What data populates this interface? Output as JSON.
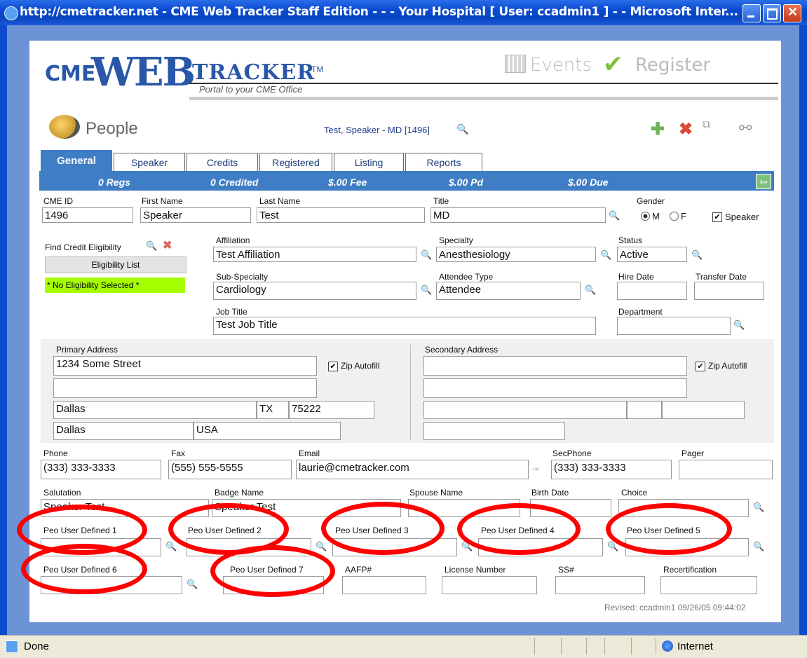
{
  "window": {
    "title": "http://cmetracker.net - CME Web Tracker Staff Edition - - - Your Hospital [ User: ccadmin1 ] - - Microsoft Inter..."
  },
  "header": {
    "logo_cme": "CME",
    "logo_web": "WEB",
    "logo_tracker": "TRACKER",
    "logo_tm": "TM",
    "tagline": "Portal to your CME Office",
    "events_label": "Events",
    "register_label": "Register"
  },
  "people": {
    "label": "People",
    "record_title": "Test, Speaker - MD [1496]"
  },
  "tabs": [
    {
      "label": "General"
    },
    {
      "label": "Speaker"
    },
    {
      "label": "Credits"
    },
    {
      "label": "Registered"
    },
    {
      "label": "Listing"
    },
    {
      "label": "Reports"
    }
  ],
  "stats": {
    "regs": "0 Regs",
    "credited": "0 Credited",
    "fee": "$.00 Fee",
    "pd": "$.00 Pd",
    "due": "$.00 Due"
  },
  "form": {
    "cme_id": {
      "label": "CME ID",
      "value": "1496"
    },
    "first_name": {
      "label": "First Name",
      "value": "Speaker"
    },
    "last_name": {
      "label": "Last Name",
      "value": "Test"
    },
    "title": {
      "label": "Title",
      "value": "MD"
    },
    "gender": {
      "label": "Gender",
      "m": "M",
      "f": "F",
      "selected": "M"
    },
    "speaker_check": {
      "label": "Speaker",
      "checked": true
    },
    "eligibility": {
      "label": "Find Credit Eligibility",
      "list_button": "Eligibility List",
      "none": "* No Eligibility Selected *"
    },
    "affiliation": {
      "label": "Affiliation",
      "value": "Test Affiliation"
    },
    "specialty": {
      "label": "Specialty",
      "value": "Anesthesiology"
    },
    "status": {
      "label": "Status",
      "value": "Active"
    },
    "sub_specialty": {
      "label": "Sub-Specialty",
      "value": "Cardiology"
    },
    "attendee_type": {
      "label": "Attendee Type",
      "value": "Attendee"
    },
    "hire_date": {
      "label": "Hire Date",
      "value": ""
    },
    "transfer_date": {
      "label": "Transfer Date",
      "value": ""
    },
    "job_title": {
      "label": "Job Title",
      "value": "Test Job Title"
    },
    "department": {
      "label": "Department",
      "value": ""
    },
    "primary_address": {
      "label": "Primary Address",
      "line1": "1234 Some Street",
      "line2": "",
      "city": "Dallas",
      "state": "TX",
      "zip": "75222",
      "county": "Dallas",
      "country": "USA",
      "zip_autofill": "Zip Autofill"
    },
    "secondary_address": {
      "label": "Secondary Address",
      "zip_autofill": "Zip Autofill"
    },
    "phone": {
      "label": "Phone",
      "value": "(333) 333-3333"
    },
    "fax": {
      "label": "Fax",
      "value": "(555) 555-5555"
    },
    "email": {
      "label": "Email",
      "value": "laurie@cmetracker.com"
    },
    "secphone": {
      "label": "SecPhone",
      "value": "(333) 333-3333"
    },
    "pager": {
      "label": "Pager",
      "value": ""
    },
    "salutation": {
      "label": "Salutation",
      "value": "Speaker Test"
    },
    "badge_name": {
      "label": "Badge Name",
      "value": "Speaker Test"
    },
    "spouse_name": {
      "label": "Spouse Name",
      "value": ""
    },
    "birth_date": {
      "label": "Birth Date",
      "value": ""
    },
    "choice": {
      "label": "Choice",
      "value": ""
    },
    "udf": [
      {
        "label": "Peo User Defined 1"
      },
      {
        "label": "Peo User Defined 2"
      },
      {
        "label": "Peo User Defined 3"
      },
      {
        "label": "Peo User Defined 4"
      },
      {
        "label": "Peo User Defined 5"
      },
      {
        "label": "Peo User Defined 6"
      },
      {
        "label": "Peo User Defined 7"
      }
    ],
    "aafp": {
      "label": "AAFP#"
    },
    "license": {
      "label": "License Number"
    },
    "ss": {
      "label": "SS#"
    },
    "recert": {
      "label": "Recertification"
    }
  },
  "revised": "Revised: ccadmin1 09/26/05 09:44:02",
  "statusbar": {
    "status": "Done",
    "zone": "Internet"
  },
  "colors": {
    "title_bar": "#0a4ad0",
    "tab_bar": "#3f7dc4",
    "eligibility_none_bg": "#a6ff00",
    "annotation_oval": "#ff0000",
    "logo_blue": "#2a57a8"
  }
}
